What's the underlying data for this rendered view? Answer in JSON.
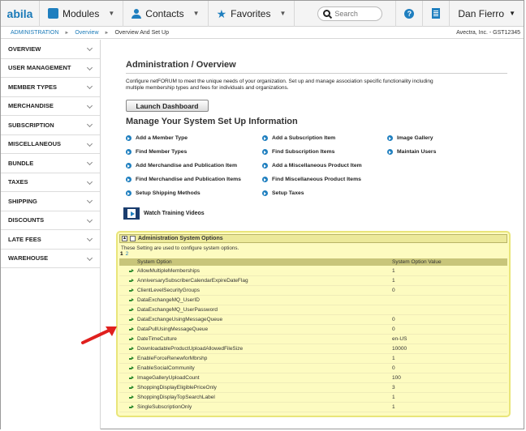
{
  "app": {
    "logo": "abila",
    "menus": [
      {
        "label": "Modules",
        "icon": "puzzle-icon"
      },
      {
        "label": "Contacts",
        "icon": "user-icon"
      },
      {
        "label": "Favorites",
        "icon": "star-icon"
      }
    ],
    "search_placeholder": "Search",
    "user_name": "Dan Fierro"
  },
  "breadcrumb": {
    "items": [
      "ADMINISTRATION",
      "Overview",
      "Overview And Set Up"
    ],
    "org": "Avectra, Inc. - GST12345"
  },
  "sidebar": {
    "items": [
      {
        "label": "OVERVIEW"
      },
      {
        "label": "USER MANAGEMENT"
      },
      {
        "label": "MEMBER TYPES"
      },
      {
        "label": "MERCHANDISE"
      },
      {
        "label": "SUBSCRIPTION"
      },
      {
        "label": "MISCELLANEOUS"
      },
      {
        "label": "BUNDLE"
      },
      {
        "label": "TAXES"
      },
      {
        "label": "SHIPPING"
      },
      {
        "label": "DISCOUNTS"
      },
      {
        "label": "LATE FEES"
      },
      {
        "label": "WAREHOUSE"
      }
    ]
  },
  "main": {
    "title": "Administration / Overview",
    "description": "Configure netFORUM to meet the unique needs of your organization. Set up and manage association specific functionality including multiple membership types and fees for individuals and organizations.",
    "launch_button": "Launch Dashboard",
    "setup_title": "Manage Your System Set Up Information",
    "links": {
      "col1": [
        "Add a Member Type",
        "Find Member Types",
        "Add Merchandise and Publication Item",
        "Find Merchandise and Publication Items",
        "Setup Shipping Methods"
      ],
      "col2": [
        "Add a Subscription Item",
        "Find Subscription Items",
        "Add a Miscellaneous Product Item",
        "Find Miscellaneous Product Items",
        "Setup Taxes"
      ],
      "col3": [
        "Image Gallery",
        "Maintain Users"
      ]
    },
    "video_link": "Watch Training Videos"
  },
  "options_panel": {
    "title": "Administration System Options",
    "note": "These Setting are used to configure system options.",
    "pages": [
      "1",
      "2"
    ],
    "columns": [
      "System Option",
      "System Option Value"
    ],
    "rows": [
      {
        "option": "AllowMultipleMemberships",
        "value": "1"
      },
      {
        "option": "AnniversarySubscriberCalendarExpireDateFlag",
        "value": "1"
      },
      {
        "option": "ClientLevelSecurityGroups",
        "value": "0"
      },
      {
        "option": "DataExchangeMQ_UserID",
        "value": ""
      },
      {
        "option": "DataExchangeMQ_UserPassword",
        "value": ""
      },
      {
        "option": "DataExchangeUsingMessageQueue",
        "value": "0"
      },
      {
        "option": "DataPullUsingMessageQueue",
        "value": "0"
      },
      {
        "option": "DateTimeCulture",
        "value": "en-US"
      },
      {
        "option": "DownloadableProductUploadAllowedFileSize",
        "value": "10000"
      },
      {
        "option": "EnableForceRenewforMbrshp",
        "value": "1"
      },
      {
        "option": "EnableSocialCommunity",
        "value": "0"
      },
      {
        "option": "ImageGalleryUploadCount",
        "value": "100"
      },
      {
        "option": "ShoppingDisplayEligiblePriceOnly",
        "value": "3"
      },
      {
        "option": "ShoppingDisplayTopSearchLabel",
        "value": "1"
      },
      {
        "option": "SingleSubscriptionOnly",
        "value": "1"
      }
    ]
  },
  "colors": {
    "accent": "#1f7fbf",
    "panel_bg": "#fdfbc0",
    "annotation_arrow": "#e0201e"
  }
}
